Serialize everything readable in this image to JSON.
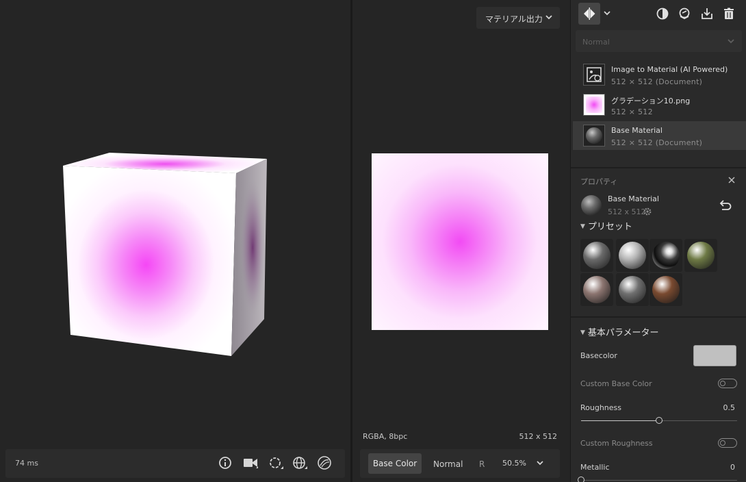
{
  "viewport3d": {
    "frame_time": "74 ms",
    "tools": [
      "info-icon",
      "camera-icon",
      "environment-icon",
      "globe-icon",
      "material-ball-icon"
    ]
  },
  "viewport2d": {
    "export_label": "マテリアル出力",
    "format": "RGBA, 8bpc",
    "size": "512 x 512",
    "channels": {
      "base": "Base Color",
      "normal": "Normal",
      "r": "R",
      "zoom": "50.5%"
    }
  },
  "panel": {
    "blend_mode": "Normal",
    "layers": [
      {
        "name": "Image to Material (AI Powered)",
        "sub": "512 × 512 (Document)",
        "thumb": "image-to-material-icon",
        "selected": false
      },
      {
        "name": "グラデーション10.png",
        "sub": "512 × 512",
        "thumb": "gradient-thumbnail",
        "selected": false
      },
      {
        "name": "Base Material",
        "sub": "512 × 512 (Document)",
        "thumb": "material-sphere-thumbnail",
        "selected": true
      }
    ],
    "properties": {
      "title": "プロパティ",
      "material_name": "Base Material",
      "material_size": "512 x 512"
    },
    "presets": {
      "title": "プリセット",
      "items": [
        "preset-plastic-dark",
        "preset-plastic-light",
        "preset-chrome",
        "preset-olive",
        "preset-rose",
        "preset-metal-grey",
        "preset-copper"
      ],
      "colors": [
        "#6a6a6a",
        "#b4b4b4",
        "#303030",
        "#6e7a45",
        "#8c7570",
        "#707070",
        "#7a4a30"
      ]
    },
    "basic_params": {
      "title": "基本パラメーター",
      "basecolor_label": "Basecolor",
      "basecolor_value": "#c0c0c0",
      "custom_base_color_label": "Custom Base Color",
      "roughness_label": "Roughness",
      "roughness_value": "0.5",
      "roughness": 0.5,
      "custom_roughness_label": "Custom Roughness",
      "metallic_label": "Metallic",
      "metallic_value": "0",
      "metallic": 0
    }
  }
}
